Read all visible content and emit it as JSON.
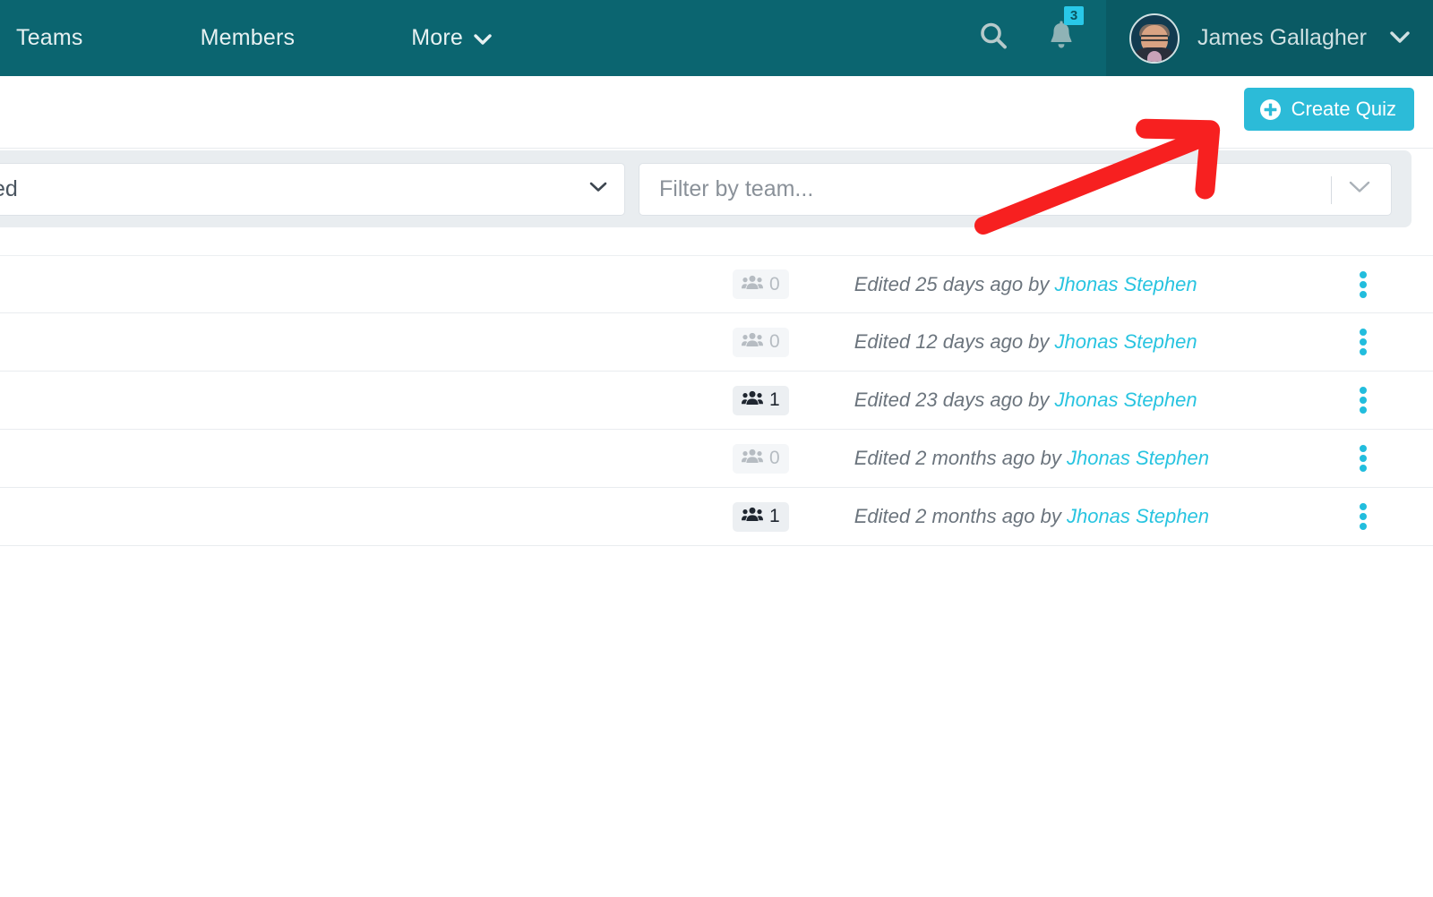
{
  "topbar": {
    "nav_items": [
      {
        "label": "Teams",
        "icon": ""
      },
      {
        "label": "Members",
        "icon": ""
      },
      {
        "label": "More",
        "icon": "chevron-down-icon"
      }
    ],
    "search_icon": "search-icon",
    "notifications": {
      "icon": "bell-icon",
      "badge_count": "3"
    },
    "user": {
      "name": "James Gallagher",
      "avatar": "user-avatar-photo",
      "caret_icon": "chevron-down-icon"
    },
    "bg_color": "#0b6570",
    "user_panel_color": "#0a5a64"
  },
  "action_bar": {
    "create_quiz": {
      "label": "Create Quiz",
      "icon": "plus-circle-icon",
      "color": "#2cbbd8"
    }
  },
  "filter_bar": {
    "sort_select": {
      "value": "ted",
      "icon": "chevron-down-icon"
    },
    "team_select": {
      "placeholder": "Filter by team...",
      "icon": "chevron-down-icon"
    },
    "bg_color": "#e9edf0"
  },
  "quiz_list": {
    "rows": [
      {
        "members_icon": "users-group-icon",
        "members_count": "0",
        "members_state": "zero",
        "edited_prefix": "Edited 25 days ago by",
        "edited_author": "Jhonas Stephen",
        "menu_icon": "vertical-dots-icon"
      },
      {
        "members_icon": "users-group-icon",
        "members_count": "0",
        "members_state": "zero",
        "edited_prefix": "Edited 12 days ago by",
        "edited_author": "Jhonas Stephen",
        "menu_icon": "vertical-dots-icon"
      },
      {
        "members_icon": "users-group-icon",
        "members_count": "1",
        "members_state": "active",
        "edited_prefix": "Edited 23 days ago by",
        "edited_author": "Jhonas Stephen",
        "menu_icon": "vertical-dots-icon"
      },
      {
        "members_icon": "users-group-icon",
        "members_count": "0",
        "members_state": "zero",
        "edited_prefix": "Edited 2 months ago by",
        "edited_author": "Jhonas Stephen",
        "menu_icon": "vertical-dots-icon"
      },
      {
        "members_icon": "users-group-icon",
        "members_count": "1",
        "members_state": "active",
        "edited_prefix": "Edited 2 months ago by",
        "edited_author": "Jhonas Stephen",
        "menu_icon": "vertical-dots-icon"
      }
    ]
  },
  "annotation": {
    "arrow_icon": "red-arrow-pointing-up-right",
    "color": "#f72020"
  }
}
